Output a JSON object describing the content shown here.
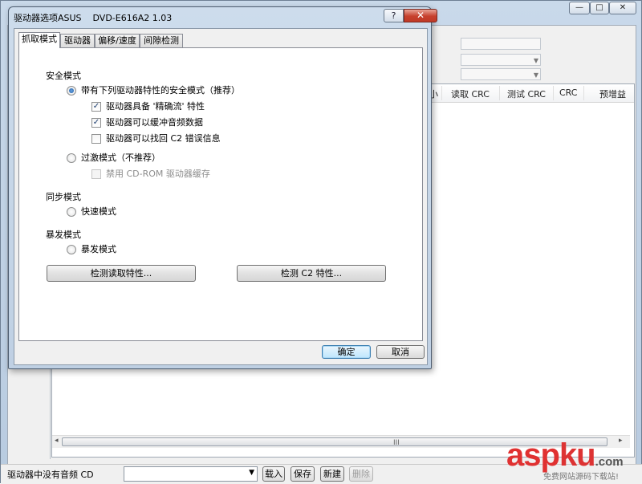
{
  "main": {
    "caption_buttons": {
      "minimize": "—",
      "maximize": "□",
      "close": "✕"
    },
    "list_columns": [
      "小",
      "读取 CRC",
      "测试 CRC",
      "CRC",
      "预增益"
    ],
    "scroll": {
      "left_arrow": "◂",
      "right_arrow": "▸",
      "grip": "III"
    },
    "status_text": "驱动器中没有音频 CD",
    "preset_value": "",
    "buttons": {
      "load": "载入",
      "save": "保存",
      "new": "新建",
      "delete": "删除"
    }
  },
  "dialog": {
    "title": "驱动器选项ASUS    DVD-E616A2 1.03",
    "help_label": "?",
    "close_label": "✕",
    "tabs": [
      "抓取模式",
      "驱动器",
      "偏移/速度",
      "间隙检测"
    ],
    "active_tab": 0,
    "security": {
      "heading": "安全模式",
      "secure_radio": "带有下列驱动器特性的安全模式（推荐）",
      "features": [
        {
          "label": "驱动器具备 '精确流' 特性",
          "checked": true
        },
        {
          "label": "驱动器可以缓冲音频数据",
          "checked": true
        },
        {
          "label": "驱动器可以找回 C2 错误信息",
          "checked": false
        }
      ],
      "paranoid_radio": "过激模式（不推荐）",
      "disable_cache": "禁用 CD-ROM 驱动器缓存"
    },
    "sync": {
      "heading": "同步模式",
      "radio": "快速模式"
    },
    "burst": {
      "heading": "暴发模式",
      "radio": "暴发模式"
    },
    "detect_read_button": "检测读取特性...",
    "detect_c2_button": "检测 C2 特性...",
    "ok_button": "确定",
    "cancel_button": "取消",
    "check_mark": "✓"
  },
  "watermark": {
    "logo_asp": "asp",
    "logo_ku": "ku",
    "logo_com": ".com",
    "subtitle": "免费网站源码下载站!"
  }
}
